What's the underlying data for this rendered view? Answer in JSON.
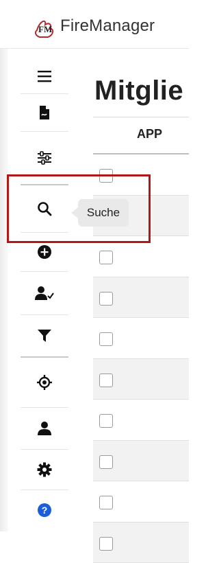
{
  "app": {
    "title": "FireManager",
    "logo_letters": "FM"
  },
  "sidebar": {
    "items": [
      {
        "icon": "hamburger-menu-icon"
      },
      {
        "icon": "pdf-file-icon"
      },
      {
        "icon": "sliders-icon"
      },
      {
        "icon": "search-icon"
      },
      {
        "icon": "plus-circle-icon"
      },
      {
        "icon": "user-check-icon"
      },
      {
        "icon": "filter-icon"
      },
      {
        "icon": "crosshair-icon"
      },
      {
        "icon": "user-icon"
      },
      {
        "icon": "gear-icon"
      },
      {
        "icon": "help-circle-icon"
      }
    ],
    "tooltip": "Suche"
  },
  "main": {
    "page_title": "Mitglie",
    "table": {
      "columns": [
        "APP"
      ],
      "row_count": 10
    }
  },
  "colors": {
    "highlight": "#b01818",
    "help_icon": "#1a5fd8",
    "tooltip_bg": "#e9e9e9"
  }
}
